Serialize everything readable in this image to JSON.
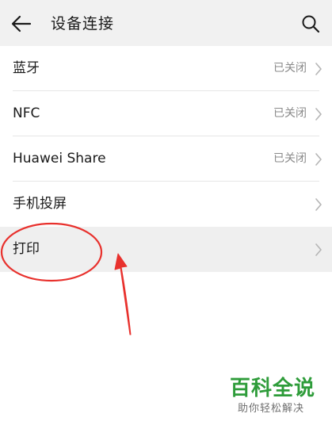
{
  "header": {
    "title": "设备连接",
    "back_icon": "arrow-left-icon",
    "search_icon": "search-icon"
  },
  "items": [
    {
      "label": "蓝牙",
      "status": "已关闭"
    },
    {
      "label": "NFC",
      "status": "已关闭"
    },
    {
      "label": "Huawei Share",
      "status": "已关闭"
    },
    {
      "label": "手机投屏",
      "status": ""
    },
    {
      "label": "打印",
      "status": ""
    }
  ],
  "colors": {
    "header_bg": "#f1f1f1",
    "highlight_bg": "#efefef",
    "annotation_red": "#e8312d",
    "watermark_green": "#2e9c3a"
  },
  "watermark": {
    "title": "百科全说",
    "subtitle": "助你轻松解决"
  }
}
